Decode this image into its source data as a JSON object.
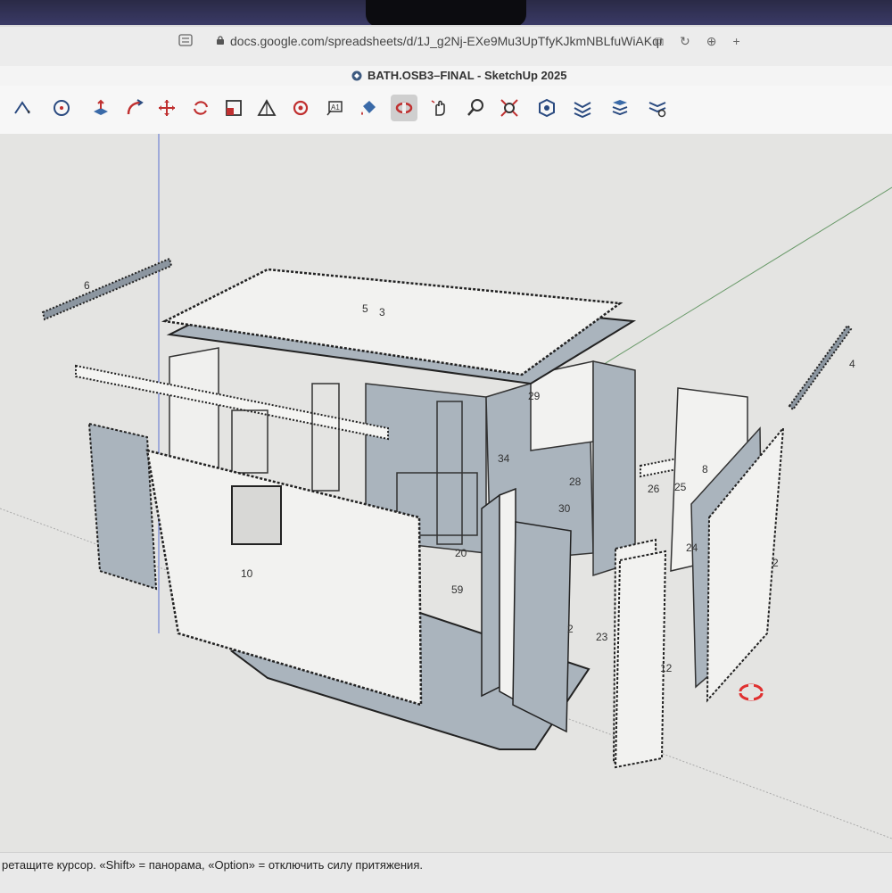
{
  "browser": {
    "url": "docs.google.com/spreadsheets/d/1J_g2Nj-EXe9Mu3UpTfyKJkmNBLfuWiAKqr"
  },
  "app": {
    "title": "BATH.OSB3–FINAL - SketchUp 2025"
  },
  "toolbar": {
    "active_tool": "orbit-tool",
    "tools": [
      "line-tool",
      "circle-tool",
      "push-pull-tool",
      "follow-me-tool",
      "move-tool",
      "rotate-tool",
      "scale-tool",
      "protractor-tool",
      "section-plane-tool",
      "text-tool",
      "paint-bucket-tool",
      "orbit-tool",
      "pan-tool",
      "zoom-tool",
      "zoom-extents-tool",
      "component-tool",
      "3d-warehouse-tool",
      "extension-tool",
      "extension-settings-tool"
    ]
  },
  "model": {
    "part_labels": [
      "6",
      "5",
      "3",
      "4",
      "29",
      "34",
      "28",
      "26",
      "25",
      "8",
      "30",
      "2",
      "24",
      "10",
      "20",
      "59",
      "23",
      "12",
      "2"
    ]
  },
  "statusbar": {
    "hint": "ретащите курсор. «Shift» = панорама, «Option» = отключить силу притяжения."
  },
  "colors": {
    "panel_light": "#f2f2f0",
    "panel_dark": "#aab4bd",
    "accent": "#e03030"
  }
}
